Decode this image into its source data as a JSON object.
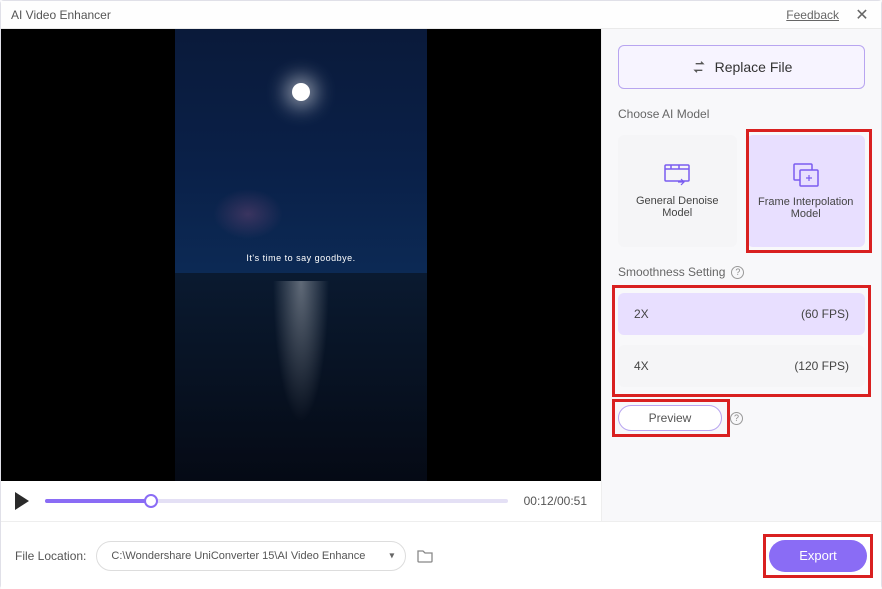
{
  "titlebar": {
    "title": "AI Video Enhancer",
    "feedback": "Feedback"
  },
  "video": {
    "caption": "It's time to say goodbye.",
    "current_time": "00:12",
    "total_time": "00:51"
  },
  "panel": {
    "replace_label": "Replace File",
    "model_section": "Choose AI Model",
    "models": [
      {
        "name": "General Denoise Model"
      },
      {
        "name": "Frame Interpolation Model"
      }
    ],
    "smooth_section": "Smoothness Setting",
    "smooth_options": [
      {
        "mult": "2X",
        "fps": "(60 FPS)"
      },
      {
        "mult": "4X",
        "fps": "(120 FPS)"
      }
    ],
    "preview": "Preview"
  },
  "footer": {
    "location_label": "File Location:",
    "location_value": "C:\\Wondershare UniConverter 15\\AI Video Enhance",
    "export": "Export"
  }
}
